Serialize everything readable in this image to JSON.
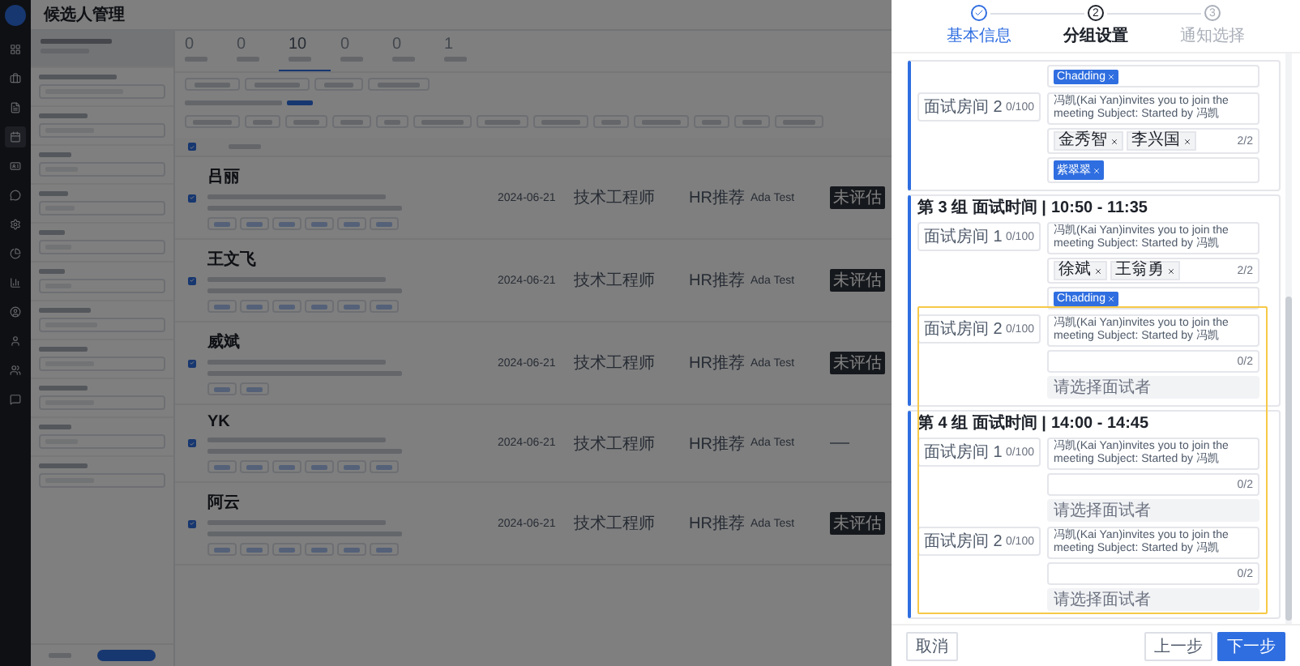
{
  "app": {
    "title": "候选人管理"
  },
  "nav_items": [
    {
      "selected": false
    },
    {
      "selected": false
    },
    {
      "selected": false
    },
    {
      "selected": true
    },
    {
      "selected": false
    },
    {
      "selected": false
    },
    {
      "selected": false
    },
    {
      "selected": false
    },
    {
      "selected": false
    },
    {
      "selected": false
    },
    {
      "selected": false
    },
    {
      "selected": false
    },
    {
      "selected": false
    }
  ],
  "stages": [
    {
      "count": "0",
      "selected": false
    },
    {
      "count": "0",
      "selected": false
    },
    {
      "count": "10",
      "selected": true
    },
    {
      "count": "0",
      "selected": false
    },
    {
      "count": "0",
      "selected": false
    },
    {
      "count": "1",
      "selected": false
    }
  ],
  "table": {
    "all_checked": true,
    "rows": [
      {
        "checked": true,
        "name": "吕丽",
        "date": "2024-06-21",
        "job": "技术工程师",
        "channel": "HR推荐",
        "owner": "Ada Test",
        "status": "未评估"
      },
      {
        "checked": true,
        "name": "王文飞",
        "date": "2024-06-21",
        "job": "技术工程师",
        "channel": "HR推荐",
        "owner": "Ada Test",
        "status": "未评估"
      },
      {
        "checked": true,
        "name": "威斌",
        "date": "2024-06-21",
        "job": "技术工程师",
        "channel": "HR推荐",
        "owner": "Ada Test",
        "status": "未评估"
      },
      {
        "checked": true,
        "name": "YK",
        "date": "2024-06-21",
        "job": "技术工程师",
        "channel": "HR推荐",
        "owner": "Ada Test"
      },
      {
        "checked": true,
        "name": "阿云",
        "date": "2024-06-21",
        "job": "技术工程师",
        "channel": "HR推荐",
        "owner": "Ada Test",
        "status": "未评估"
      }
    ]
  },
  "drawer": {
    "steps": [
      {
        "label": "基本信息",
        "completed": true,
        "selected": false
      },
      {
        "label": "分组设置",
        "completed": false,
        "selected": true,
        "number": "2"
      },
      {
        "label": "通知选择",
        "completed": false,
        "selected": false,
        "number": "3"
      }
    ],
    "highlight_frame": true,
    "groups": [
      {
        "rows": [
          {
            "candidates": {
              "tags": [
                "Chadding"
              ]
            }
          },
          {
            "room": "面试房间 2",
            "room_count": "0/100",
            "message": "冯凯(Kai Yan)invites you to join the meeting Subject: Started by 冯凯",
            "interviewers": {
              "tags": [
                "金秀智",
                "李兴国"
              ],
              "count": "2/2"
            },
            "candidates": {
              "tags": [
                "紫翠翠"
              ]
            }
          }
        ]
      },
      {
        "title": "第 3 组 面试时间 |",
        "time": "10:50 - 11:35",
        "rows": [
          {
            "room": "面试房间 1",
            "room_count": "0/100",
            "message": "冯凯(Kai Yan)invites you to join the meeting Subject: Started by 冯凯",
            "interviewers": {
              "tags": [
                "徐斌",
                "王翁勇"
              ],
              "count": "2/2"
            },
            "candidates": {
              "tags": [
                "Chadding"
              ]
            }
          },
          {
            "room": "面试房间 2",
            "room_count": "0/100",
            "message": "冯凯(Kai Yan)invites you to join the meeting Subject: Started by 冯凯",
            "interviewers": {
              "count": "0/2"
            },
            "candidates": {
              "placeholder": "请选择面试者"
            }
          }
        ]
      },
      {
        "title": "第 4 组 面试时间 |",
        "time": "14:00 - 14:45",
        "rows": [
          {
            "room": "面试房间 1",
            "room_count": "0/100",
            "message": "冯凯(Kai Yan)invites you to join the meeting Subject: Started by 冯凯",
            "interviewers": {
              "count": "0/2"
            },
            "candidates": {
              "placeholder": "请选择面试者"
            }
          },
          {
            "room": "面试房间 2",
            "room_count": "0/100",
            "message": "冯凯(Kai Yan)invites you to join the meeting Subject: Started by 冯凯",
            "interviewers": {
              "count": "0/2"
            },
            "candidates": {
              "placeholder": "请选择面试者"
            }
          }
        ]
      }
    ],
    "cancel": "取消",
    "prev": "上一步",
    "next": "下一步"
  }
}
